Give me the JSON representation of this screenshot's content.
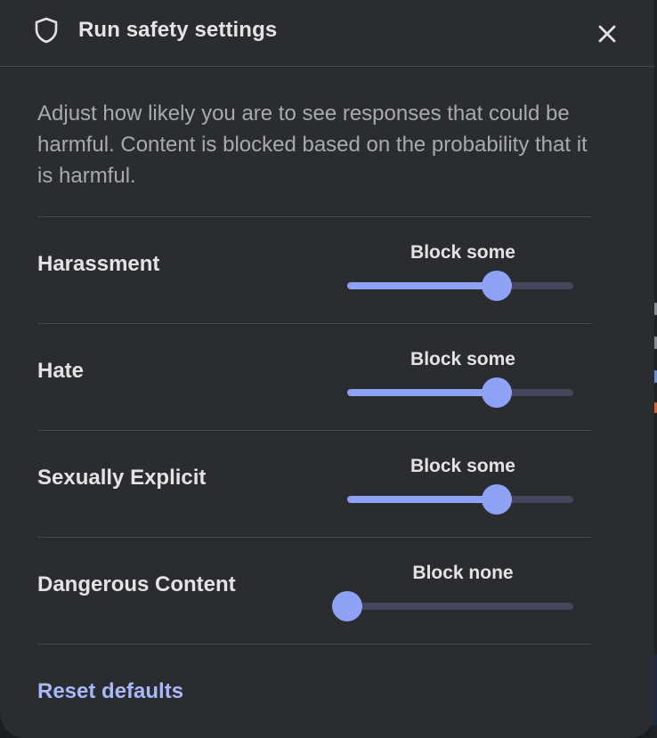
{
  "dialog": {
    "title": "Run safety settings",
    "header_icon": "shield-icon",
    "close_icon": "close-icon",
    "description": "Adjust how likely you are to see responses that could be harmful. Content is blocked based on the probability that it is harmful.",
    "reset_label": "Reset defaults"
  },
  "settings": [
    {
      "label": "Harassment",
      "value_label": "Block some",
      "level": 0.66
    },
    {
      "label": "Hate",
      "value_label": "Block some",
      "level": 0.66
    },
    {
      "label": "Sexually Explicit",
      "value_label": "Block some",
      "level": 0.66
    },
    {
      "label": "Dangerous Content",
      "value_label": "Block none",
      "level": 0.0
    }
  ],
  "colors": {
    "dialog_bg": "#2b2c2f",
    "accent": "#8ea1f5",
    "link": "#a8b8fb",
    "track": "#44475a"
  }
}
